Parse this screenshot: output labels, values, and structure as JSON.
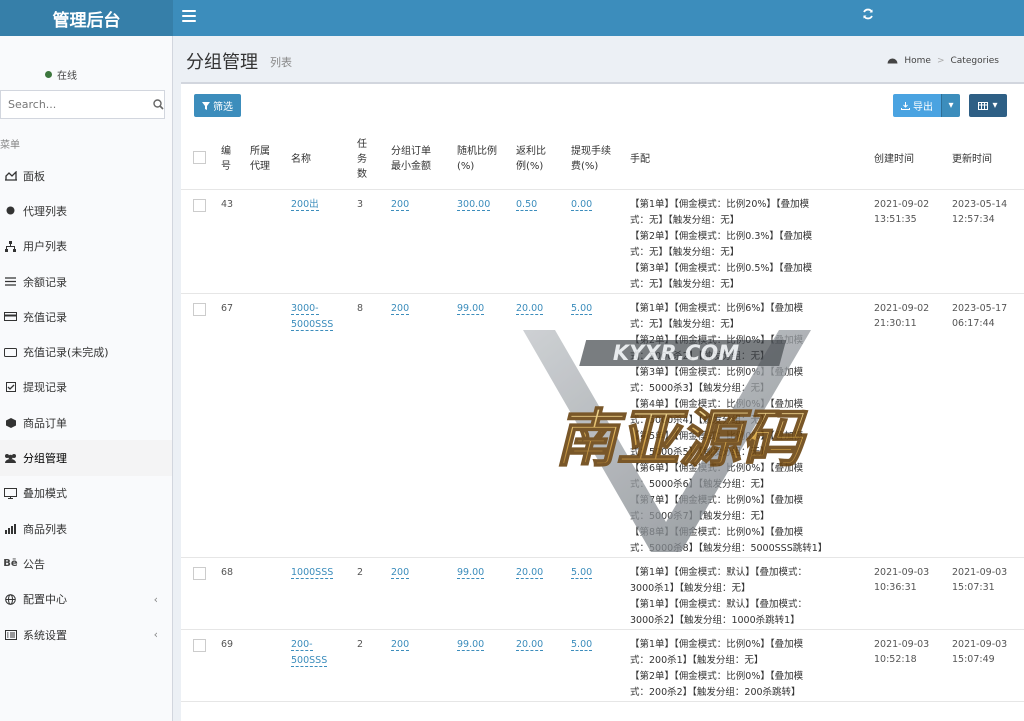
{
  "header": {
    "app_title": "管理后台"
  },
  "sidebar": {
    "status_text": "在线",
    "search_placeholder": "Search...",
    "menu_header": "菜单",
    "items": [
      {
        "label": "面板",
        "icon": "chart-icon"
      },
      {
        "label": "代理列表",
        "icon": "circle-icon"
      },
      {
        "label": "用户列表",
        "icon": "sitemap-icon"
      },
      {
        "label": "余额记录",
        "icon": "list-icon"
      },
      {
        "label": "充值记录",
        "icon": "card-icon"
      },
      {
        "label": "充值记录(未完成)",
        "icon": "card-outline-icon"
      },
      {
        "label": "提现记录",
        "icon": "check-square-icon"
      },
      {
        "label": "商品订单",
        "icon": "cube-icon"
      },
      {
        "label": "分组管理",
        "icon": "users-icon",
        "active": true
      },
      {
        "label": "叠加模式",
        "icon": "desktop-icon"
      },
      {
        "label": "商品列表",
        "icon": "signal-icon"
      },
      {
        "label": "公告",
        "icon": "behance-icon",
        "icon_text": "Bē"
      },
      {
        "label": "配置中心",
        "icon": "globe-icon",
        "has_children": true
      },
      {
        "label": "系统设置",
        "icon": "list-alt-icon",
        "has_children": true
      }
    ]
  },
  "page": {
    "title": "分组管理",
    "subtitle": "列表",
    "breadcrumb": {
      "home": "Home",
      "current": "Categories"
    }
  },
  "toolbar": {
    "filter_label": "筛选",
    "export_label": "导出"
  },
  "table": {
    "headers": {
      "id": [
        "编",
        "号"
      ],
      "agent": [
        "所属",
        "代理"
      ],
      "name": "名称",
      "tasks": [
        "任",
        "务",
        "数"
      ],
      "min_amount": [
        "分组订单",
        "最小金额"
      ],
      "random_ratio": [
        "随机比例",
        "(%)"
      ],
      "rebate": [
        "返利比",
        "例(%)"
      ],
      "fee": [
        "提现手续",
        "费(%)"
      ],
      "config": "手配",
      "created": "创建时间",
      "updated": "更新时间"
    },
    "rows": [
      {
        "id": "43",
        "agent": "",
        "name": [
          "200出"
        ],
        "tasks": "3",
        "min_amount": "200",
        "random_ratio": "300.00",
        "rebate": "0.50",
        "fee": "0.00",
        "config": [
          "【第1单】【佣金模式：比例20%】【叠加模",
          "式：无】【触发分组：无】",
          "【第2单】【佣金模式：比例0.3%】【叠加模",
          "式：无】【触发分组：无】",
          "【第3单】【佣金模式：比例0.5%】【叠加模",
          "式：无】【触发分组：无】"
        ],
        "created": [
          "2021-09-02",
          "13:51:35"
        ],
        "updated": [
          "2023-05-14",
          "12:57:34"
        ]
      },
      {
        "id": "67",
        "agent": "",
        "name": [
          "3000-",
          "5000SSS"
        ],
        "tasks": "8",
        "min_amount": "200",
        "random_ratio": "99.00",
        "rebate": "20.00",
        "fee": "5.00",
        "config": [
          "【第1单】【佣金模式：比例6%】【叠加模",
          "式：无】【触发分组：无】",
          "【第2单】【佣金模式：比例0%】【叠加模",
          "式：5000杀2】【触发分组：无】",
          "【第3单】【佣金模式：比例0%】【叠加模",
          "式：5000杀3】【触发分组：无】",
          "【第4单】【佣金模式：比例0%】【叠加模",
          "式：5000杀4】【触发分组：无】",
          "【第5单】【佣金模式：比例0%】【叠加模",
          "式：5000杀5】【触发分组：无】",
          "【第6单】【佣金模式：比例0%】【叠加模",
          "式：5000杀6】【触发分组：无】",
          "【第7单】【佣金模式：比例0%】【叠加模",
          "式：5000杀7】【触发分组：无】",
          "【第8单】【佣金模式：比例0%】【叠加模",
          "式：5000杀8】【触发分组：5000SSS跳转1】"
        ],
        "created": [
          "2021-09-02",
          "21:30:11"
        ],
        "updated": [
          "2023-05-17",
          "06:17:44"
        ]
      },
      {
        "id": "68",
        "agent": "",
        "name": [
          "1000SSS"
        ],
        "tasks": "2",
        "min_amount": "200",
        "random_ratio": "99.00",
        "rebate": "20.00",
        "fee": "5.00",
        "config": [
          "【第1单】【佣金模式：默认】【叠加模式：",
          "3000杀1】【触发分组：无】",
          "【第1单】【佣金模式：默认】【叠加模式：",
          "3000杀2】【触发分组：1000杀跳转1】"
        ],
        "created": [
          "2021-09-03",
          "10:36:31"
        ],
        "updated": [
          "2021-09-03",
          "15:07:31"
        ]
      },
      {
        "id": "69",
        "agent": "",
        "name": [
          "200-",
          "500SSS"
        ],
        "tasks": "2",
        "min_amount": "200",
        "random_ratio": "99.00",
        "rebate": "20.00",
        "fee": "5.00",
        "config": [
          "【第1单】【佣金模式：比例0%】【叠加模",
          "式：200杀1】【触发分组：无】",
          "【第2单】【佣金模式：比例0%】【叠加模",
          "式：200杀2】【触发分组：200杀跳转】"
        ],
        "created": [
          "2021-09-03",
          "10:52:18"
        ],
        "updated": [
          "2021-09-03",
          "15:07:49"
        ]
      }
    ]
  },
  "watermark": {
    "top_text": "KYXR.COM",
    "main_text": "南亚源码"
  },
  "colors": {
    "brand": "#3c8dbc",
    "brand_dark": "#367fa9",
    "link": "#3c8dbc",
    "online": "#3c763d"
  }
}
